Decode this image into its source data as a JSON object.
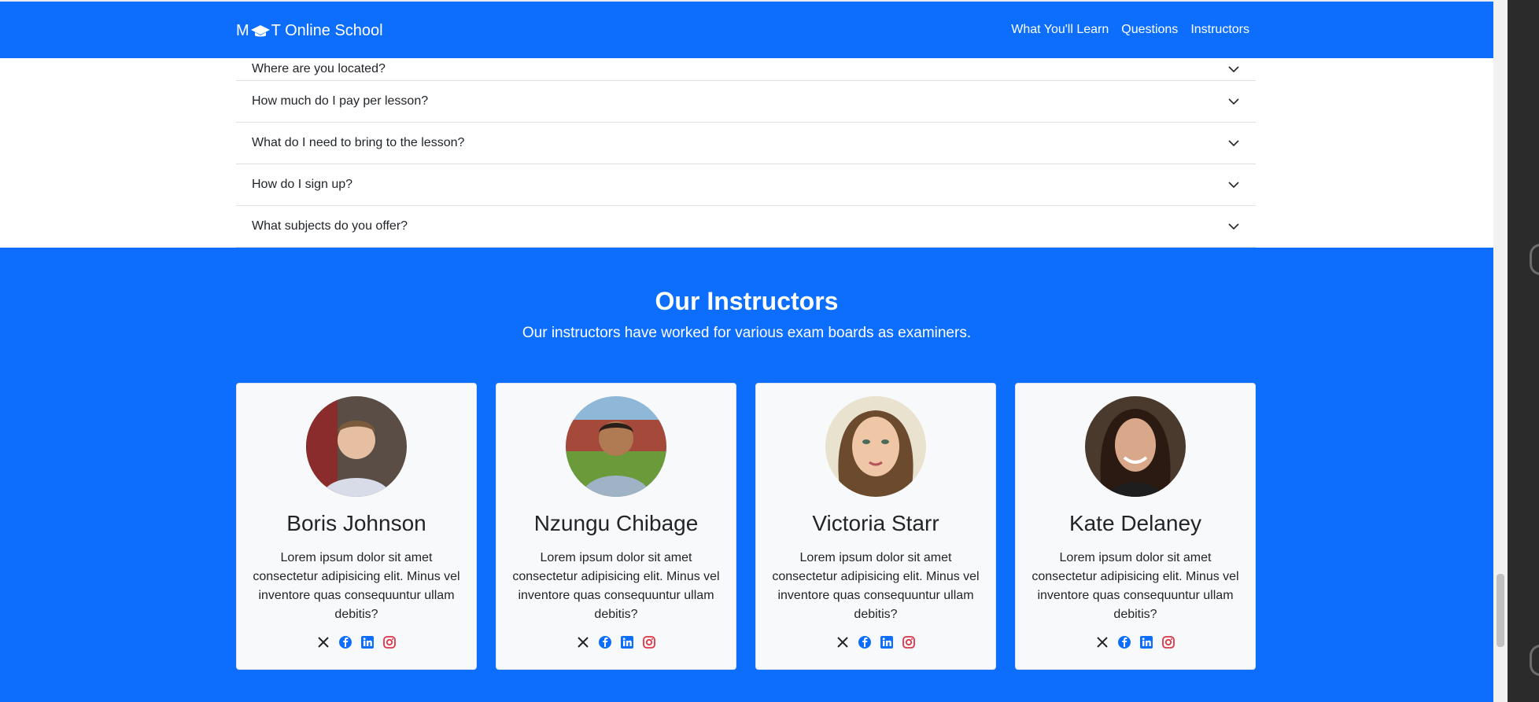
{
  "navbar": {
    "brand_prefix": "M",
    "brand_suffix": "T Online School",
    "links": [
      "What You'll Learn",
      "Questions",
      "Instructors"
    ]
  },
  "faq": {
    "items": [
      "Where are you located?",
      "How much do I pay per lesson?",
      "What do I need to bring to the lesson?",
      "How do I sign up?",
      "What subjects do you offer?"
    ]
  },
  "instructors": {
    "title": "Our Instructors",
    "subtitle": "Our instructors have worked for various exam boards as examiners.",
    "cards": [
      {
        "name": "Boris Johnson",
        "text": "Lorem ipsum dolor sit amet consectetur adipisicing elit. Minus vel inventore quas consequuntur ullam debitis?"
      },
      {
        "name": "Nzungu Chibage",
        "text": "Lorem ipsum dolor sit amet consectetur adipisicing elit. Minus vel inventore quas consequuntur ullam debitis?"
      },
      {
        "name": "Victoria Starr",
        "text": "Lorem ipsum dolor sit amet consectetur adipisicing elit. Minus vel inventore quas consequuntur ullam debitis?"
      },
      {
        "name": "Kate Delaney",
        "text": "Lorem ipsum dolor sit amet consectetur adipisicing elit. Minus vel inventore quas consequuntur ullam debitis?"
      }
    ],
    "social_icons": [
      "x-icon",
      "facebook-icon",
      "linkedin-icon",
      "instagram-icon"
    ]
  },
  "colors": {
    "primary": "#0d6efd",
    "card_bg": "#f8f9fa",
    "instagram": "#dc3545"
  }
}
